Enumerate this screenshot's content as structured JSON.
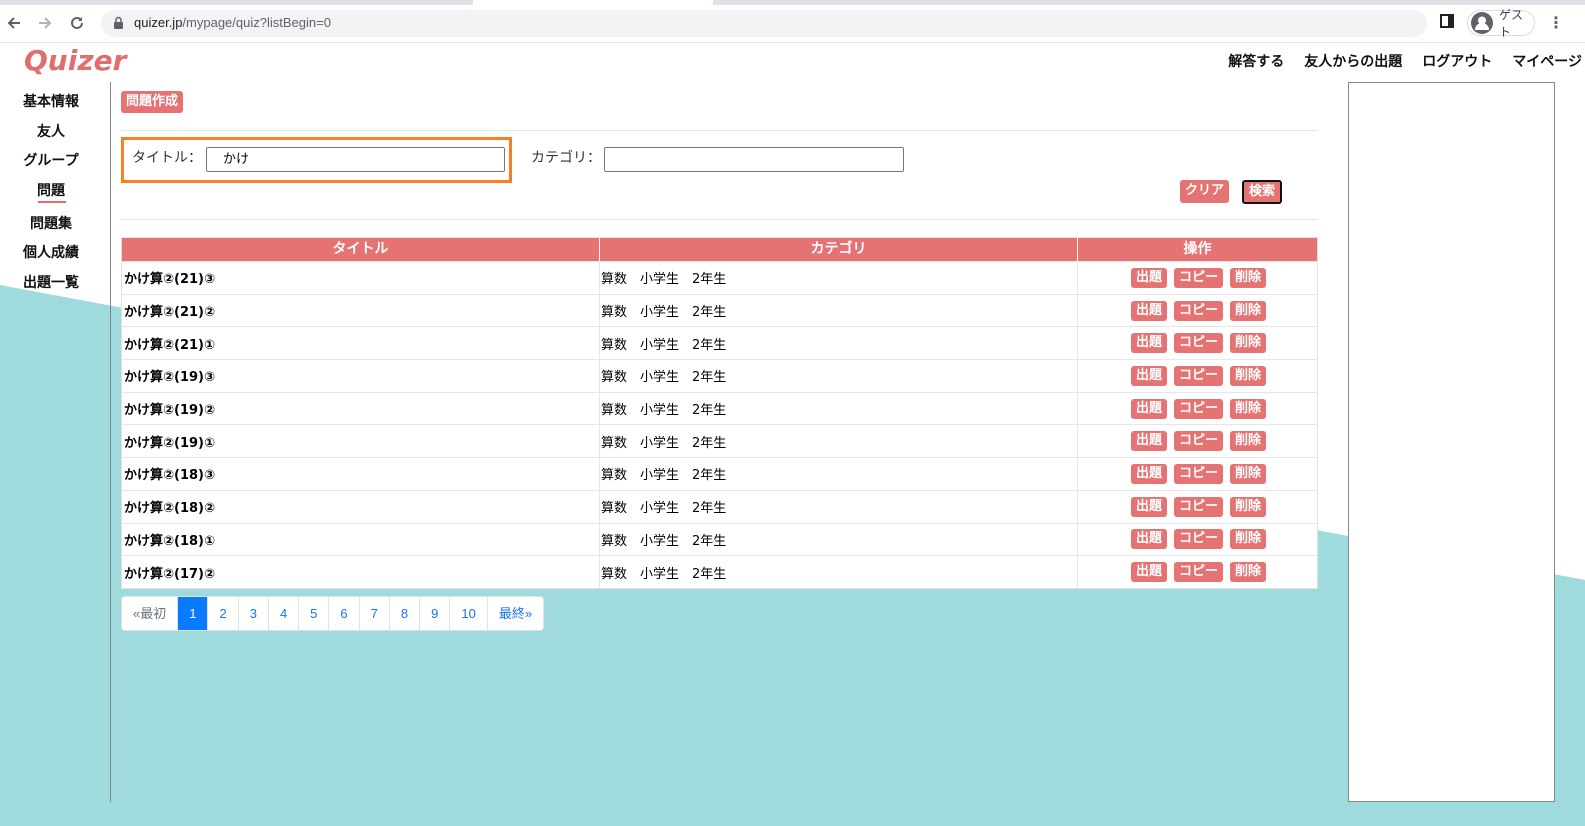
{
  "browser": {
    "url_host": "quizer.jp",
    "url_path": "/mypage/quiz?listBegin=0",
    "profile_label": "ゲスト"
  },
  "site": {
    "logo": "Quizer",
    "topnav": [
      "解答する",
      "友人からの出題",
      "ログアウト",
      "マイページ"
    ]
  },
  "sidebar": {
    "items": [
      "基本情報",
      "友人",
      "グループ",
      "問題",
      "問題集",
      "個人成績",
      "出題一覧"
    ],
    "active": "問題"
  },
  "main": {
    "create_button": "問題作成",
    "search": {
      "title_label": "タイトル：",
      "title_value": "かけ",
      "category_label": "カテゴリ：",
      "category_value": "",
      "clear_button": "クリア",
      "search_button": "検索"
    },
    "table": {
      "headers": [
        "タイトル",
        "カテゴリ",
        "操作"
      ],
      "action_labels": [
        "出題",
        "コピー",
        "削除"
      ],
      "rows": [
        {
          "title": "かけ算②(21)③",
          "category": "算数　小学生　2年生"
        },
        {
          "title": "かけ算②(21)②",
          "category": "算数　小学生　2年生"
        },
        {
          "title": "かけ算②(21)①",
          "category": "算数　小学生　2年生"
        },
        {
          "title": "かけ算②(19)③",
          "category": "算数　小学生　2年生"
        },
        {
          "title": "かけ算②(19)②",
          "category": "算数　小学生　2年生"
        },
        {
          "title": "かけ算②(19)①",
          "category": "算数　小学生　2年生"
        },
        {
          "title": "かけ算②(18)③",
          "category": "算数　小学生　2年生"
        },
        {
          "title": "かけ算②(18)②",
          "category": "算数　小学生　2年生"
        },
        {
          "title": "かけ算②(18)①",
          "category": "算数　小学生　2年生"
        },
        {
          "title": "かけ算②(17)②",
          "category": "算数　小学生　2年生"
        }
      ]
    },
    "pagination": {
      "first": "«最初",
      "pages": [
        "1",
        "2",
        "3",
        "4",
        "5",
        "6",
        "7",
        "8",
        "9",
        "10"
      ],
      "active": "1",
      "last": "最終»"
    }
  },
  "colors": {
    "accent": "#e57373",
    "logo": "#e06e6e",
    "teal_bg": "#9fdbdc",
    "highlight": "#f58025",
    "page_active": "#0a7bff"
  }
}
